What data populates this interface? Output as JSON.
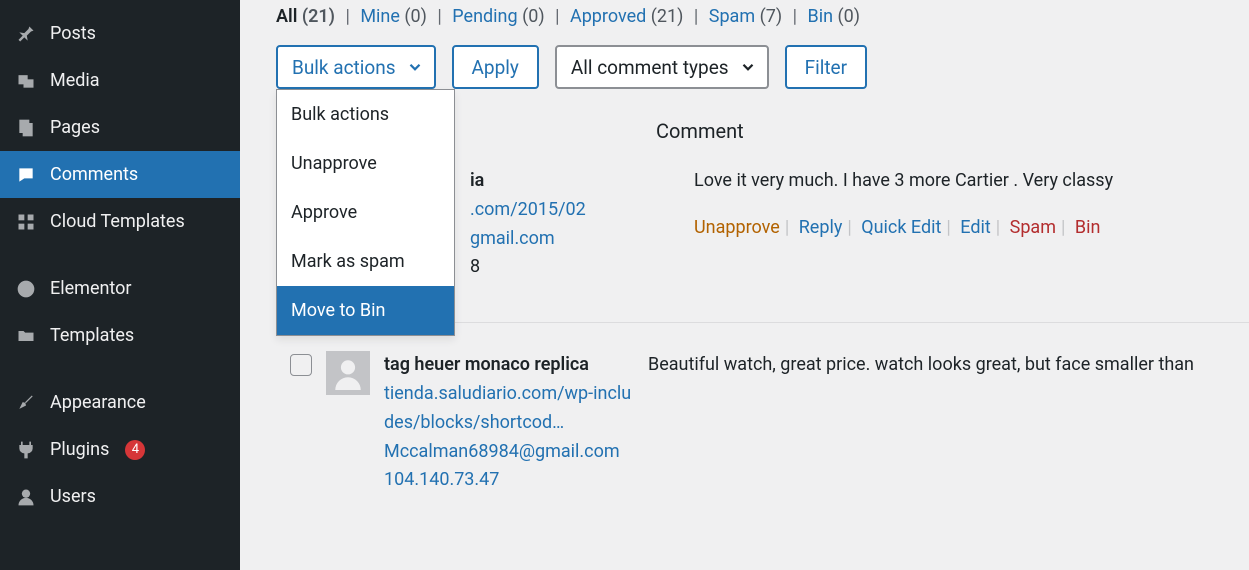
{
  "sidebar": {
    "items": [
      {
        "label": "Posts"
      },
      {
        "label": "Media"
      },
      {
        "label": "Pages"
      },
      {
        "label": "Comments"
      },
      {
        "label": "Cloud Templates"
      },
      {
        "label": "Elementor"
      },
      {
        "label": "Templates"
      },
      {
        "label": "Appearance"
      },
      {
        "label": "Plugins"
      },
      {
        "label": "Users"
      }
    ],
    "plugins_badge": "4"
  },
  "filters": {
    "all_label": "All",
    "all_count": "(21)",
    "mine_label": "Mine",
    "mine_count": "(0)",
    "pending_label": "Pending",
    "pending_count": "(0)",
    "approved_label": "Approved",
    "approved_count": "(21)",
    "spam_label": "Spam",
    "spam_count": "(7)",
    "bin_label": "Bin",
    "bin_count": "(0)"
  },
  "toolbar": {
    "bulk_selected": "Bulk actions",
    "apply": "Apply",
    "comment_types": "All comment types",
    "filter": "Filter",
    "bulk_options": {
      "o0": "Bulk actions",
      "o1": "Unapprove",
      "o2": "Approve",
      "o3": "Mark as spam",
      "o4": "Move to Bin"
    }
  },
  "columns": {
    "comment": "Comment"
  },
  "rows": [
    {
      "author_name_suffix": "ia",
      "url_suffix": ".com/2015/02",
      "email_suffix": "gmail.com",
      "ip_suffix": "8",
      "comment_text": "Love it very much. I have 3 more Cartier . Very classy"
    },
    {
      "author_name": "tag heuer monaco replica",
      "url": "tienda.saludiario.com/wp-includes/blocks/shortcod…",
      "email": "Mccalman68984@gmail.com",
      "ip": "104.140.73.47",
      "comment_text": "Beautiful watch, great price. watch looks great, but face smaller than "
    }
  ],
  "actions": {
    "unapprove": "Unapprove",
    "reply": "Reply",
    "quick_edit": "Quick Edit",
    "edit": "Edit",
    "spam": "Spam",
    "bin": "Bin"
  }
}
